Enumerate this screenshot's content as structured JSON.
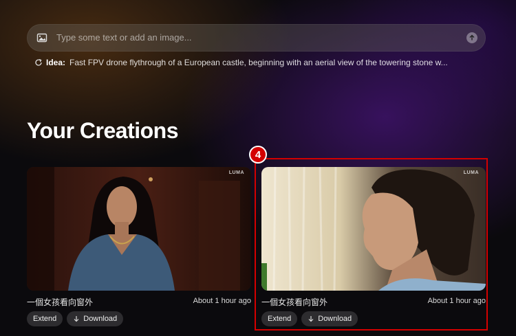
{
  "prompt": {
    "placeholder": "Type some text or add an image...",
    "icons": {
      "image": "image-icon",
      "send": "arrow-up-icon"
    }
  },
  "idea": {
    "label": "Idea:",
    "text": "Fast FPV drone flythrough of a European castle, beginning with an aerial view of the towering stone w..."
  },
  "page": {
    "title": "Your Creations"
  },
  "creations": [
    {
      "watermark": "LUMA",
      "caption": "一個女孩看向窗外",
      "time": "About 1 hour ago",
      "extend_label": "Extend",
      "download_label": "Download"
    },
    {
      "watermark": "LUMA",
      "caption": "一個女孩看向窗外",
      "time": "About 1 hour ago",
      "extend_label": "Extend",
      "download_label": "Download"
    }
  ],
  "annotation": {
    "badge": "4",
    "color": "#d40000"
  }
}
